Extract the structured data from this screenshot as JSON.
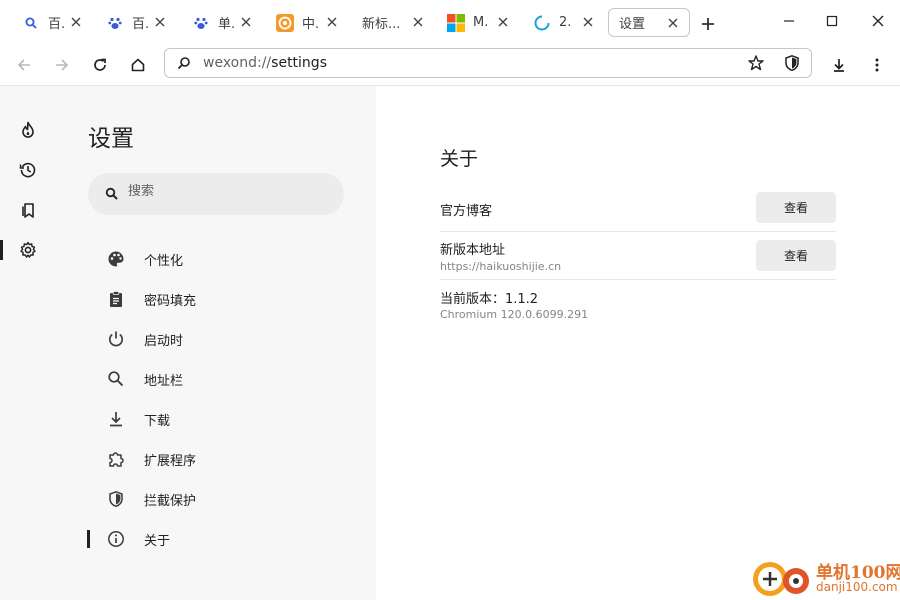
{
  "tabs": [
    {
      "label": "百.",
      "icon": "search-icon"
    },
    {
      "label": "百.",
      "icon": "baidu-paw-icon"
    },
    {
      "label": "单.",
      "icon": "baidu-paw-icon"
    },
    {
      "label": "中.",
      "icon": "orange-target-icon"
    },
    {
      "label": "新标...",
      "icon": ""
    },
    {
      "label": "M.",
      "icon": "microsoft-logo-icon"
    },
    {
      "label": "2.",
      "icon": "loading-spinner-icon"
    },
    {
      "label": "设置",
      "icon": "",
      "active": true
    }
  ],
  "address": {
    "scheme": "wexond://",
    "host": "settings"
  },
  "settings": {
    "title": "设置",
    "search_placeholder": "搜索",
    "nav": [
      {
        "label": "个性化",
        "icon": "palette-icon"
      },
      {
        "label": "密码填充",
        "icon": "clipboard-icon"
      },
      {
        "label": "启动时",
        "icon": "power-icon"
      },
      {
        "label": "地址栏",
        "icon": "search-icon"
      },
      {
        "label": "下载",
        "icon": "download-icon"
      },
      {
        "label": "扩展程序",
        "icon": "puzzle-icon"
      },
      {
        "label": "拦截保护",
        "icon": "shield-icon"
      },
      {
        "label": "关于",
        "icon": "info-icon",
        "active": true
      }
    ]
  },
  "about": {
    "title": "关于",
    "blog_label": "官方博客",
    "blog_button": "查看",
    "newver_label": "新版本地址",
    "newver_url": "https://haikuoshijie.cn",
    "newver_button": "查看",
    "version_label": "当前版本：1.1.2",
    "chromium": "Chromium 120.0.6099.291"
  },
  "watermark": {
    "text_cn": "单机100网",
    "text_url": "danji100.com"
  },
  "colors": {
    "rail_bg": "#f7f7f7",
    "button_bg": "#ececec",
    "watermark": "#e0752c"
  }
}
